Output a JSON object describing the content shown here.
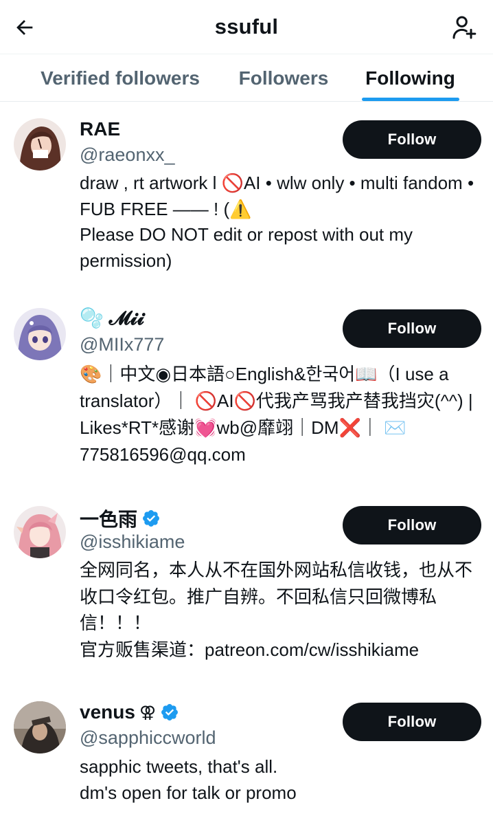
{
  "header": {
    "title": "ssuful"
  },
  "tabs": [
    {
      "label": "Verified followers",
      "active": false
    },
    {
      "label": "Followers",
      "active": false
    },
    {
      "label": "Following",
      "active": true
    }
  ],
  "colors": {
    "accent": "#1d9bf0",
    "text": "#0f1419",
    "muted": "#536471",
    "button_bg": "#0f1419"
  },
  "users": [
    {
      "name": "RAE",
      "handle": "@raeonxx_",
      "verified": false,
      "button_label": "Follow",
      "bio": "draw , rt artwork l 🚫AI • wlw only • multi fandom • FUB FREE —— !                              (⚠️\nPlease DO NOT edit or repost with out my permission)"
    },
    {
      "name": "🫧 𝓜𝓲𝓲",
      "handle": "@MIIx777",
      "verified": false,
      "button_label": "Follow",
      "bio": "🎨｜中文◉日本語○English&한국어📖（I use a translator）｜ 🚫AI🚫代我产骂我产替我挡灾(^^) | Likes*RT*感谢💓wb@靡翊｜DM❌｜ ✉️775816596@qq.com"
    },
    {
      "name": "一色雨",
      "handle": "@isshikiame",
      "verified": true,
      "button_label": "Follow",
      "bio": "全网同名，本人从不在国外网站私信收钱，也从不收口令红包。推广自辨。不回私信只回微博私信！！！\n官方贩售渠道：patreon.com/cw/isshikiame"
    },
    {
      "name": "venus",
      "name_symbol": "⚢",
      "handle": "@sapphiccworld",
      "verified": true,
      "button_label": "Follow",
      "bio": "sapphic tweets, that's all.\ndm's open for talk or promo"
    }
  ]
}
